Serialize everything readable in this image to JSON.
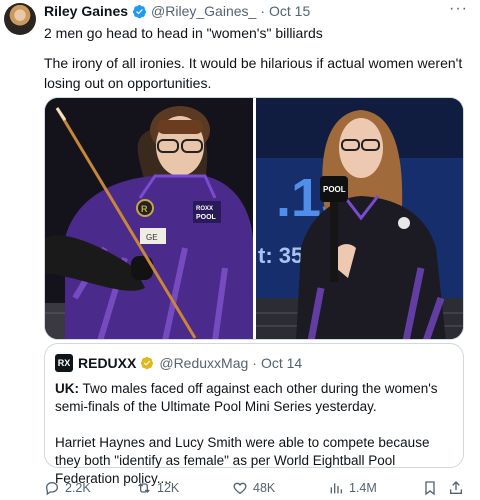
{
  "author": {
    "name": "Riley Gaines",
    "handle": "@Riley_Gaines_",
    "date": "Oct 15"
  },
  "tweet": {
    "line1": "2 men go head to head in \"women's\" billiards",
    "line2": "The irony of all ironies. It would be hilarious if actual women weren't losing out on opportunities."
  },
  "media": {
    "left_shirt_brand": "POOL",
    "left_shirt_top": "ROXX",
    "right_screen_text": "t: 35",
    "right_screen_num": ".15",
    "right_mic_label": "POOL"
  },
  "quote": {
    "logo": "RX",
    "name": "REDUXX",
    "handle": "@ReduxxMag",
    "date": "Oct 14",
    "lead": "UK:",
    "p1": "Two males faced off against each other during the women's semi-finals of the Ultimate Pool Mini Series yesterday.",
    "p2": "Harriet Haynes and Lucy Smith were able to compete because they both \"identify as female\" as per World Eightball Pool Federation policy...."
  },
  "actions": {
    "replies": "2.2K",
    "retweets": "12K",
    "likes": "48K",
    "views": "1.4M"
  },
  "colors": {
    "verified": "#1d9bf0",
    "gold_badge": "#e2b719",
    "muted": "#536471",
    "border": "#cfd9de"
  }
}
